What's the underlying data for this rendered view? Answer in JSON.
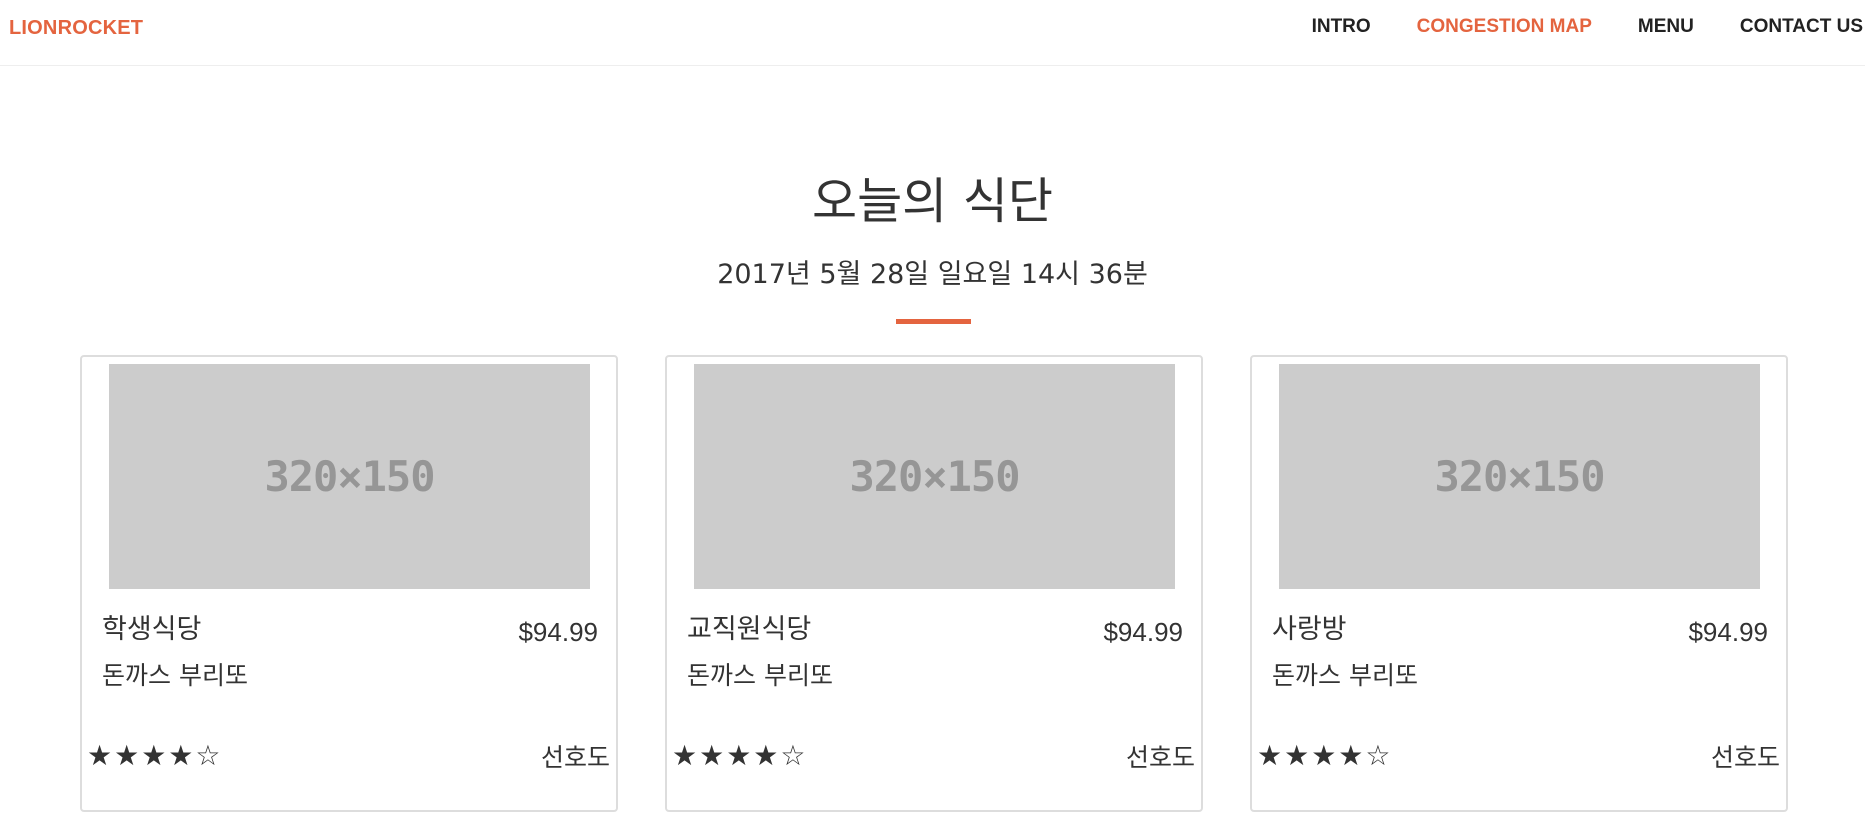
{
  "navbar": {
    "brand": "LIONROCKET",
    "links": [
      {
        "label": "INTRO",
        "active": false
      },
      {
        "label": "CONGESTION MAP",
        "active": true
      },
      {
        "label": "MENU",
        "active": false
      },
      {
        "label": "CONTACT US",
        "active": false
      }
    ]
  },
  "header": {
    "title": "오늘의 식단",
    "date": "2017년 5월 28일 일요일 14시 36분"
  },
  "cards": [
    {
      "image_label": "320×150",
      "name": "학생식당",
      "price": "$94.99",
      "menu": "돈까스 부리또",
      "stars": "★★★★☆",
      "rating_label": "선호도"
    },
    {
      "image_label": "320×150",
      "name": "교직원식당",
      "price": "$94.99",
      "menu": "돈까스 부리또",
      "stars": "★★★★☆",
      "rating_label": "선호도"
    },
    {
      "image_label": "320×150",
      "name": "사랑방",
      "price": "$94.99",
      "menu": "돈까스 부리또",
      "stars": "★★★★☆",
      "rating_label": "선호도"
    }
  ],
  "colors": {
    "accent": "#e4643f",
    "text": "#333333",
    "placeholder_bg": "#cccccc",
    "placeholder_text": "#969696",
    "card_border": "#dddddd"
  }
}
